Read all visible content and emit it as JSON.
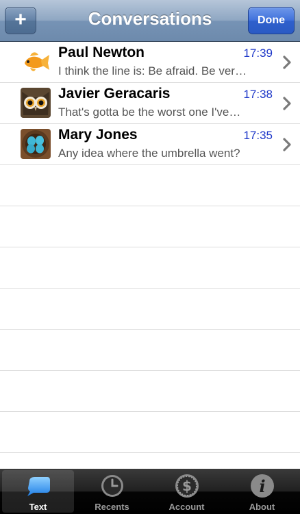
{
  "navbar": {
    "title": "Conversations",
    "add_label": "+",
    "done_label": "Done"
  },
  "conversations": [
    {
      "name": "Paul Newton",
      "time": "17:39",
      "preview": "I think the line is: Be afraid. Be ver…",
      "avatar_icon": "goldfish-icon"
    },
    {
      "name": "Javier Geracaris",
      "time": "17:38",
      "preview": "That's gotta be the worst one I've…",
      "avatar_icon": "owl-icon"
    },
    {
      "name": "Mary Jones",
      "time": "17:35",
      "preview": "Any idea where the umbrella went?",
      "avatar_icon": "bird-eggs-icon"
    }
  ],
  "tabs": [
    {
      "label": "Text",
      "icon": "speech-bubble-icon",
      "active": true
    },
    {
      "label": "Recents",
      "icon": "clock-icon",
      "active": false
    },
    {
      "label": "Account",
      "icon": "dollar-coin-icon",
      "active": false
    },
    {
      "label": "About",
      "icon": "info-icon",
      "active": false
    }
  ],
  "colors": {
    "time_text": "#1c36c8",
    "done_button": "#3f70db",
    "navbar": "#8ea6c2"
  }
}
